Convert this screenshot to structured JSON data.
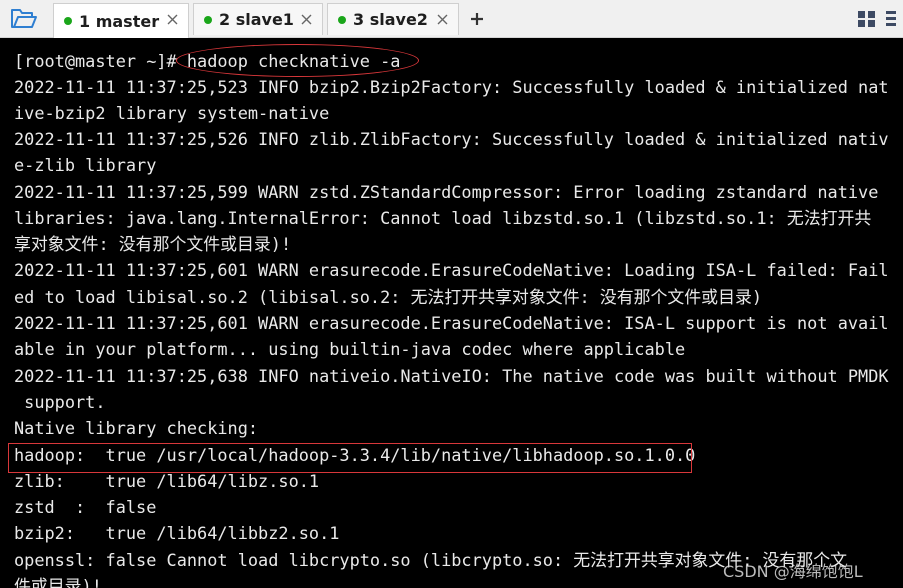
{
  "toolbar": {
    "open_icon": "folder-open-icon"
  },
  "tabs": [
    {
      "label": "1 master",
      "status_color": "#1aa61a",
      "active": true
    },
    {
      "label": "2 slave1",
      "status_color": "#1aa61a",
      "active": false
    },
    {
      "label": "3 slave2",
      "status_color": "#1aa61a",
      "active": false
    }
  ],
  "tab_controls": {
    "close_icon": "close-icon",
    "new_tab_icon": "plus-icon",
    "layout_icon": "grid-icon",
    "menu_icon": "more-vertical-icon"
  },
  "terminal": {
    "background": "#000000",
    "foreground": "#e9e9e9",
    "highlight_color": "#d8373a",
    "lines": [
      "[root@master ~]# hadoop checknative -a",
      "2022-11-11 11:37:25,523 INFO bzip2.Bzip2Factory: Successfully loaded & initialized nat",
      "ive-bzip2 library system-native",
      "2022-11-11 11:37:25,526 INFO zlib.ZlibFactory: Successfully loaded & initialized nativ",
      "e-zlib library",
      "2022-11-11 11:37:25,599 WARN zstd.ZStandardCompressor: Error loading zstandard native",
      "libraries: java.lang.InternalError: Cannot load libzstd.so.1 (libzstd.so.1: 无法打开共",
      "享对象文件: 没有那个文件或目录)!",
      "2022-11-11 11:37:25,601 WARN erasurecode.ErasureCodeNative: Loading ISA-L failed: Fail",
      "ed to load libisal.so.2 (libisal.so.2: 无法打开共享对象文件: 没有那个文件或目录)",
      "2022-11-11 11:37:25,601 WARN erasurecode.ErasureCodeNative: ISA-L support is not avail",
      "able in your platform... using builtin-java codec where applicable",
      "2022-11-11 11:37:25,638 INFO nativeio.NativeIO: The native code was built without PMDK",
      " support.",
      "Native library checking:",
      "hadoop:  true /usr/local/hadoop-3.3.4/lib/native/libhadoop.so.1.0.0",
      "zlib:    true /lib64/libz.so.1",
      "zstd  :  false",
      "bzip2:   true /lib64/libbz2.so.1",
      "openssl: false Cannot load libcrypto.so (libcrypto.so: 无法打开共享对象文件: 没有那个文",
      "件或目录)!"
    ]
  },
  "watermark": "CSDN @海绵饱饱L"
}
